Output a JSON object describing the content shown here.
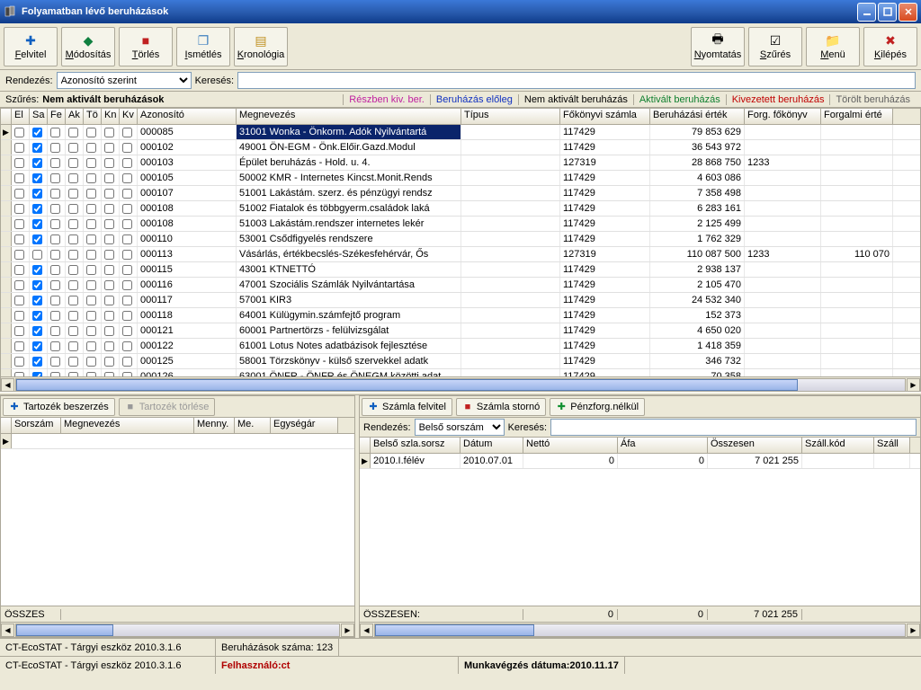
{
  "window": {
    "title": "Folyamatban lévő beruházások"
  },
  "toolbar": {
    "felvitel": "Felvitel",
    "modositas": "Módosítás",
    "torles": "Törlés",
    "ismetles": "Ismétlés",
    "kronologia": "Kronológia",
    "nyomtatas": "Nyomtatás",
    "szures": "Szűrés",
    "menu": "Menü",
    "kilepes": "Kilépés"
  },
  "sortbar": {
    "rendezes_lbl": "Rendezés:",
    "rendezes_val": "Azonosító szerint",
    "kereses_lbl": "Keresés:",
    "kereses_val": ""
  },
  "filter": {
    "lbl": "Szűrés:",
    "val": "Nem aktivált beruházások",
    "tags": {
      "reszben": "Részben kiv. ber.",
      "eloleg": "Beruházás előleg",
      "nemaktivalt": "Nem aktivált beruházás",
      "aktivalt": "Aktivált beruházás",
      "kivezetett": "Kivezetett beruházás",
      "torolt": "Törölt beruházás"
    }
  },
  "grid": {
    "headers": {
      "el": "El",
      "sa": "Sa",
      "fe": "Fe",
      "ak": "Ak",
      "to": "Tö",
      "kn": "Kn",
      "kv": "Kv",
      "azonosito": "Azonosító",
      "megnevezes": "Megnevezés",
      "tipus": "Típus",
      "fokonyvi": "Főkönyvi számla",
      "beruhazasi": "Beruházási érték",
      "forgfokonyv": "Forg. főkönyv",
      "forgalmi": "Forgalmi érté"
    },
    "rows": [
      {
        "sa": true,
        "azon": "000085",
        "meg": "31001 Wonka - Önkorm. Adók Nyilvántartá",
        "fok": "117429",
        "ber": "79 853 629",
        "ff": "",
        "fe": ""
      },
      {
        "sa": true,
        "azon": "000102",
        "meg": "49001 ÖN-EGM - Önk.Előir.Gazd.Modul",
        "fok": "117429",
        "ber": "36 543 972",
        "ff": "",
        "fe": ""
      },
      {
        "sa": true,
        "azon": "000103",
        "meg": "Épület beruházás - Hold. u. 4.",
        "fok": "127319",
        "ber": "28 868 750",
        "ff": "1233",
        "fe": ""
      },
      {
        "sa": true,
        "azon": "000105",
        "meg": "50002 KMR - Internetes Kincst.Monit.Rends",
        "fok": "117429",
        "ber": "4 603 086",
        "ff": "",
        "fe": ""
      },
      {
        "sa": true,
        "azon": "000107",
        "meg": "51001 Lakástám. szerz. és pénzügyi rendsz",
        "fok": "117429",
        "ber": "7 358 498",
        "ff": "",
        "fe": ""
      },
      {
        "sa": true,
        "azon": "000108",
        "meg": "51002 Fiatalok és többgyerm.családok laká",
        "fok": "117429",
        "ber": "6 283 161",
        "ff": "",
        "fe": ""
      },
      {
        "sa": true,
        "azon": "000108",
        "meg": "51003  Lakástám.rendszer internetes lekér",
        "fok": "117429",
        "ber": "2 125 499",
        "ff": "",
        "fe": ""
      },
      {
        "sa": true,
        "azon": "000110",
        "meg": "53001 Csődfigyelés rendszere",
        "fok": "117429",
        "ber": "1 762 329",
        "ff": "",
        "fe": ""
      },
      {
        "sa": false,
        "azon": "000113",
        "meg": "Vásárlás, értékbecslés-Székesfehérvár, Ős",
        "fok": "127319",
        "ber": "110 087 500",
        "ff": "1233",
        "fe": "110 070"
      },
      {
        "sa": true,
        "azon": "000115",
        "meg": "43001 KTNETTÓ",
        "fok": "117429",
        "ber": "2 938 137",
        "ff": "",
        "fe": ""
      },
      {
        "sa": true,
        "azon": "000116",
        "meg": "47001 Szociális Számlák Nyilvántartása",
        "fok": "117429",
        "ber": "2 105 470",
        "ff": "",
        "fe": ""
      },
      {
        "sa": true,
        "azon": "000117",
        "meg": "57001 KIR3",
        "fok": "117429",
        "ber": "24 532 340",
        "ff": "",
        "fe": ""
      },
      {
        "sa": true,
        "azon": "000118",
        "meg": "64001 Külügymin.számfejtő program",
        "fok": "117429",
        "ber": "152 373",
        "ff": "",
        "fe": ""
      },
      {
        "sa": true,
        "azon": "000121",
        "meg": "60001 Partnertörzs - felülvizsgálat",
        "fok": "117429",
        "ber": "4 650 020",
        "ff": "",
        "fe": ""
      },
      {
        "sa": true,
        "azon": "000122",
        "meg": "61001 Lotus Notes adatbázisok fejlesztése",
        "fok": "117429",
        "ber": "1 418 359",
        "ff": "",
        "fe": ""
      },
      {
        "sa": true,
        "azon": "000125",
        "meg": "58001 Törzskönyv - külső szervekkel adatk",
        "fok": "117429",
        "ber": "346 732",
        "ff": "",
        "fe": ""
      },
      {
        "sa": true,
        "azon": "000126",
        "meg": "63001 ÖNFR - ÖNFR és ÖNEGM közötti adat",
        "fok": "117429",
        "ber": "70 358",
        "ff": "",
        "fe": ""
      }
    ]
  },
  "left_panel": {
    "btn_add": "Tartozék beszerzés",
    "btn_del": "Tartozék törlése",
    "headers": {
      "sorszam": "Sorszám",
      "megnevezes": "Megnevezés",
      "menny": "Menny.",
      "me": "Me.",
      "egysegar": "Egységár"
    },
    "footer": "ÖSSZES"
  },
  "right_panel": {
    "btn_add": "Számla felvitel",
    "btn_storno": "Számla stornó",
    "btn_penz": "Pénzforg.nélkül",
    "rendezes_lbl": "Rendezés:",
    "rendezes_val": "Belső sorszám",
    "kereses_lbl": "Keresés:",
    "headers": {
      "belso": "Belső szla.sorsz",
      "datum": "Dátum",
      "netto": "Nettó",
      "afa": "Áfa",
      "osszesen": "Összesen",
      "szallkod": "Száll.kód",
      "szall": "Száll"
    },
    "row": {
      "belso": "2010.I.félév",
      "datum": "2010.07.01",
      "netto": "0",
      "afa": "0",
      "osszesen": "7 021 255",
      "szallkod": "",
      "szall": ""
    },
    "footer_lbl": "ÖSSZESEN:",
    "footer_netto": "0",
    "footer_afa": "0",
    "footer_ossz": "7 021 255"
  },
  "status1": {
    "app": "CT-EcoSTAT - Tárgyi eszköz 2010.3.1.6",
    "count": "Beruházások száma: 123"
  },
  "status2": {
    "app": "CT-EcoSTAT - Tárgyi eszköz 2010.3.1.6",
    "user_lbl": "Felhasználó:",
    "user_val": " ct",
    "date_lbl": "Munkavégzés dátuma:",
    "date_val": " 2010.11.17"
  }
}
